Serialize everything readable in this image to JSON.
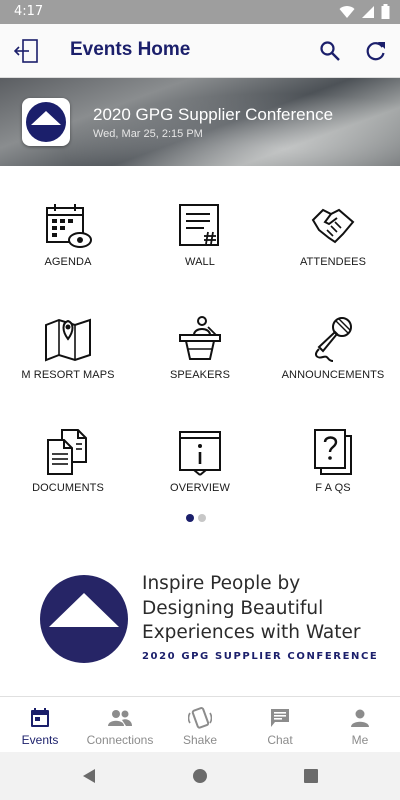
{
  "status_bar": {
    "time": "4:17"
  },
  "app_bar": {
    "title": "Events Home"
  },
  "event": {
    "title": "2020 GPG Supplier Conference",
    "date": "Wed, Mar 25, 2:15 PM"
  },
  "tiles": [
    {
      "label": "AGENDA",
      "icon": "calendar-eye-icon"
    },
    {
      "label": "WALL",
      "icon": "document-hashtag-icon"
    },
    {
      "label": "ATTENDEES",
      "icon": "handshake-icon"
    },
    {
      "label": "M RESORT MAPS",
      "icon": "map-pin-icon"
    },
    {
      "label": "SPEAKERS",
      "icon": "podium-speaker-icon"
    },
    {
      "label": "ANNOUNCEMENTS",
      "icon": "microphone-icon"
    },
    {
      "label": "DOCUMENTS",
      "icon": "documents-icon"
    },
    {
      "label": "OVERVIEW",
      "icon": "info-board-icon"
    },
    {
      "label": "F A QS",
      "icon": "question-cards-icon"
    }
  ],
  "pager": {
    "pages": 2,
    "current": 1
  },
  "branding": {
    "tagline": [
      "Inspire People by",
      "Designing Beautiful",
      "Experiences with Water"
    ],
    "conference": "2020 GPG SUPPLIER CONFERENCE"
  },
  "bottom_nav": [
    {
      "label": "Events",
      "icon": "calendar-icon",
      "active": true
    },
    {
      "label": "Connections",
      "icon": "people-icon",
      "active": false
    },
    {
      "label": "Shake",
      "icon": "shake-phone-icon",
      "active": false
    },
    {
      "label": "Chat",
      "icon": "chat-bubble-icon",
      "active": false
    },
    {
      "label": "Me",
      "icon": "person-icon",
      "active": false
    }
  ],
  "colors": {
    "brand": "#1b1f6b",
    "status_bar": "#9e9e9e",
    "inactive": "#8c8c8c"
  }
}
